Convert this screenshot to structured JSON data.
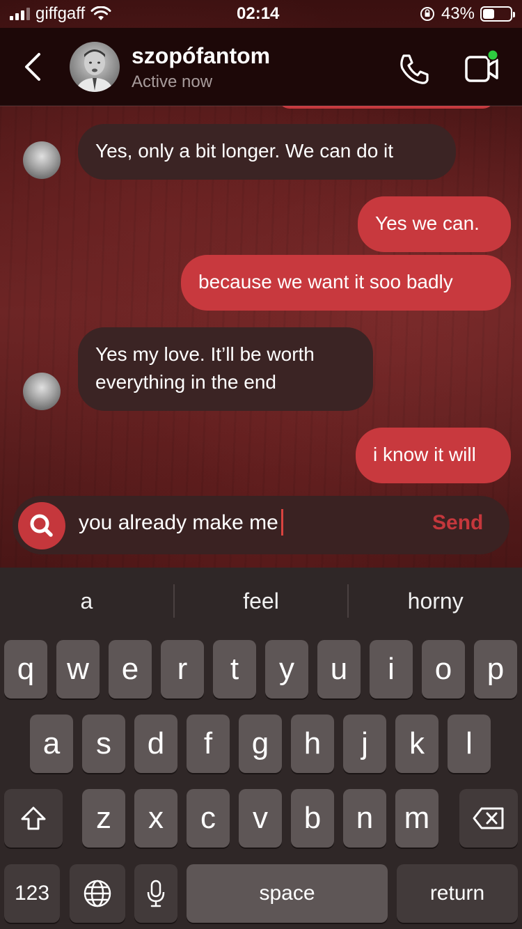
{
  "status_bar": {
    "carrier": "giffgaff",
    "time": "02:14",
    "battery_percent": "43%",
    "battery_level": 0.43,
    "icons": [
      "signal-icon",
      "wifi-icon",
      "orientation-lock-icon",
      "battery-icon"
    ]
  },
  "header": {
    "contact_name": "szopófantom",
    "contact_status": "Active now",
    "icons": [
      "back-chevron-icon",
      "phone-icon",
      "video-call-icon"
    ],
    "online_dot_color": "#2ecc40"
  },
  "messages": [
    {
      "direction": "in",
      "text": "Yes, only a bit longer. We can do it"
    },
    {
      "direction": "out",
      "text": "Yes we can."
    },
    {
      "direction": "out",
      "text": "because we want it soo badly"
    },
    {
      "direction": "in",
      "lines": [
        "Yes my love. It’ll be worth",
        "everything in the end"
      ]
    },
    {
      "direction": "out",
      "text": "i know it will"
    }
  ],
  "composer": {
    "value": "you already make me",
    "send_label": "Send",
    "search_icon": "search-icon"
  },
  "keyboard": {
    "suggestions": [
      "a",
      "feel",
      "horny"
    ],
    "row1": [
      "q",
      "w",
      "e",
      "r",
      "t",
      "y",
      "u",
      "i",
      "o",
      "p"
    ],
    "row2": [
      "a",
      "s",
      "d",
      "f",
      "g",
      "h",
      "j",
      "k",
      "l"
    ],
    "row3": [
      "z",
      "x",
      "c",
      "v",
      "b",
      "n",
      "m"
    ],
    "numbers_label": "123",
    "space_label": "space",
    "return_label": "return",
    "icons": [
      "shift-icon",
      "backspace-icon",
      "globe-icon",
      "microphone-icon"
    ]
  },
  "colors": {
    "accent": "#c8393e",
    "incoming_bubble": "#3b2424",
    "header_bg": "#1d0808",
    "keyboard_bg": "#2f2727",
    "key_bg": "#5e5656"
  }
}
